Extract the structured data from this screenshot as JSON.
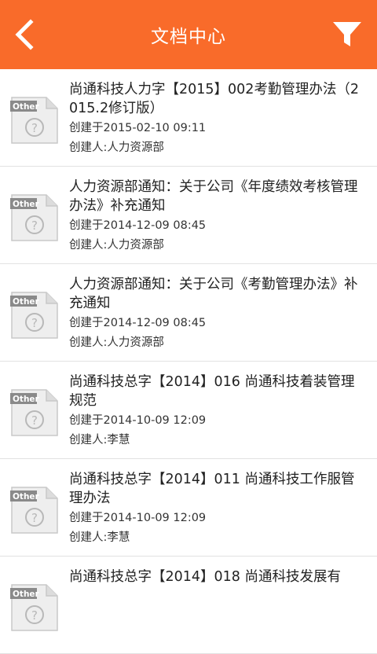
{
  "header": {
    "title": "文档中心",
    "back_icon": "chevron-left-icon",
    "filter_icon": "filter-icon",
    "bg_color": "#f96b2a"
  },
  "documents": [
    {
      "name": "尚通科技人力字【2015】002考勤管理办法（2015.2修订版）",
      "created": "创建于2015-02-10 09:11",
      "creator": "创建人:人力资源部",
      "icon_label": "Other"
    },
    {
      "name": "人力资源部通知：关于公司《年度绩效考核管理办法》补充通知",
      "created": "创建于2014-12-09 08:45",
      "creator": "创建人:人力资源部",
      "icon_label": "Other"
    },
    {
      "name": "人力资源部通知：关于公司《考勤管理办法》补充通知",
      "created": "创建于2014-12-09 08:45",
      "creator": "创建人:人力资源部",
      "icon_label": "Other"
    },
    {
      "name": "尚通科技总字【2014】016 尚通科技着装管理规范",
      "created": "创建于2014-10-09 12:09",
      "creator": "创建人:李慧",
      "icon_label": "Other"
    },
    {
      "name": "尚通科技总字【2014】011 尚通科技工作服管理办法",
      "created": "创建于2014-10-09 12:09",
      "creator": "创建人:李慧",
      "icon_label": "Other"
    },
    {
      "name": "尚通科技总字【2014】018 尚通科技发展有",
      "created": "",
      "creator": "",
      "icon_label": "Other"
    }
  ]
}
